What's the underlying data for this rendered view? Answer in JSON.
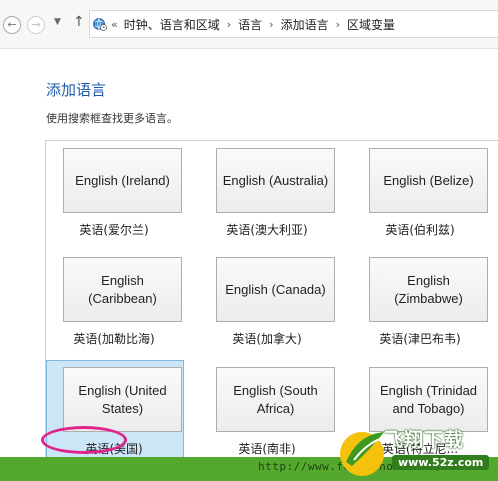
{
  "navigation": {
    "back_icon": "back-arrow",
    "forward_icon": "forward-arrow",
    "recent_icon": "chevron-down",
    "up_icon": "up-arrow",
    "location_icon": "globe-clock",
    "overflow": "«",
    "breadcrumbs": [
      "时钟、语言和区域",
      "语言",
      "添加语言",
      "区域变量"
    ]
  },
  "page": {
    "title": "添加语言",
    "description": "使用搜索框查找更多语言。"
  },
  "languages": [
    {
      "tile": "English (Ireland)",
      "label": "英语(爱尔兰)",
      "selected": false
    },
    {
      "tile": "English (Australia)",
      "label": "英语(澳大利亚)",
      "selected": false
    },
    {
      "tile": "English (Belize)",
      "label": "英语(伯利兹)",
      "selected": false
    },
    {
      "tile": "English (Caribbean)",
      "label": "英语(加勒比海)",
      "selected": false
    },
    {
      "tile": "English (Canada)",
      "label": "英语(加拿大)",
      "selected": false
    },
    {
      "tile": "English (Zimbabwe)",
      "label": "英语(津巴布韦)",
      "selected": false
    },
    {
      "tile": "English (United States)",
      "label": "英语(美国)",
      "selected": true
    },
    {
      "tile": "English (South Africa)",
      "label": "英语(南非)",
      "selected": false
    },
    {
      "tile": "English (Trinidad and Tobago)",
      "label": "英语(特立尼...",
      "selected": false
    }
  ],
  "colors": {
    "title": "#1e5aa8",
    "selection": "#cde6f7",
    "highlight_circle": "#e0248c",
    "watermark_green": "#53a82d"
  },
  "watermark": {
    "url_text": "http://www.feixiahome.com/xiazai",
    "brand": "飞翔下载",
    "brand_url": "www.52z.com"
  }
}
